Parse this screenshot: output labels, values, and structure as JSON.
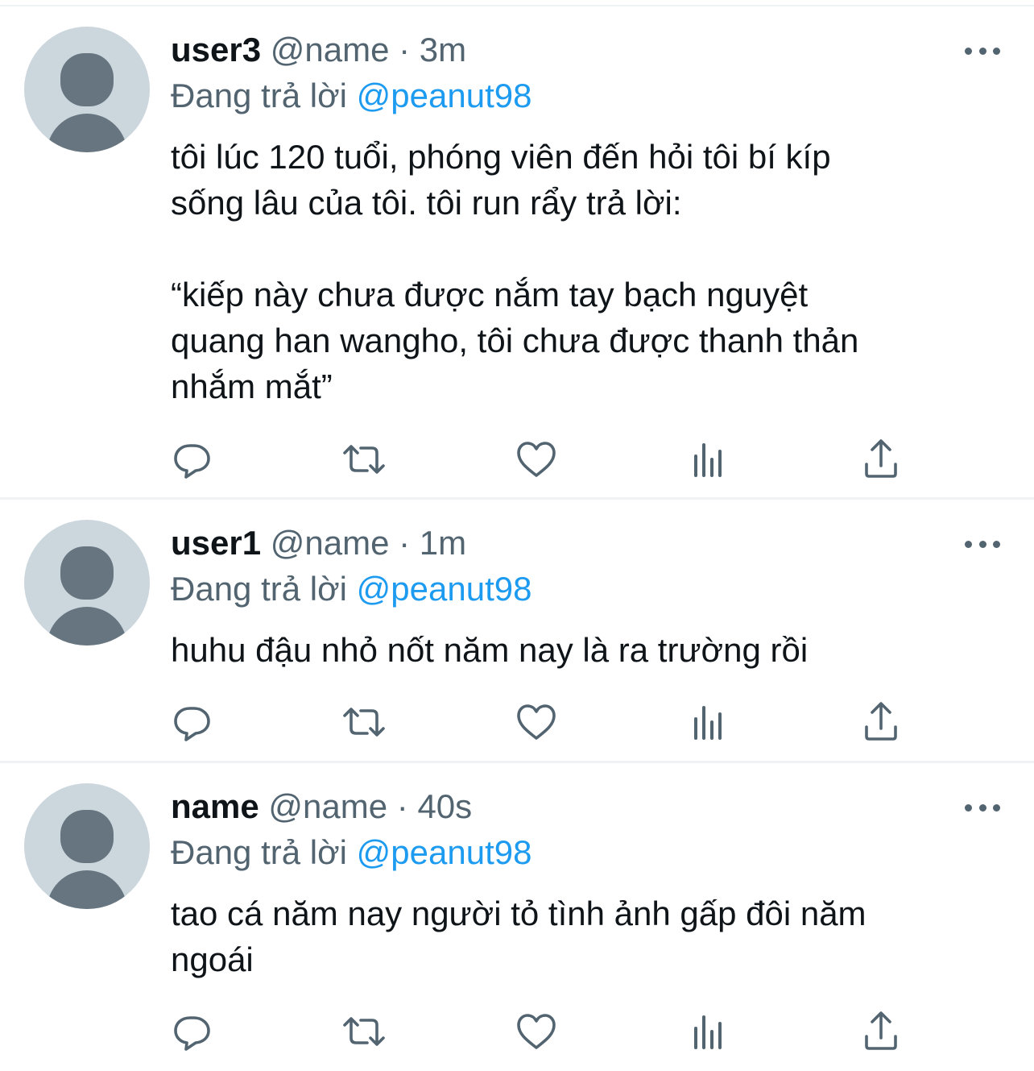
{
  "reply_prefix": "Đang trả lời",
  "more_icon": "more-horizontal-icon",
  "action_icons": [
    "reply-icon",
    "retweet-icon",
    "like-icon",
    "analytics-icon",
    "share-icon"
  ],
  "colors": {
    "text": "#0f1419",
    "secondary": "#536471",
    "mention": "#1d9bf0",
    "avatar_bg": "#ccd6dd",
    "avatar_fg": "#66757f",
    "divider": "#eff3f4"
  },
  "tweets": [
    {
      "display_name": "user3",
      "handle": "@name",
      "separator": "·",
      "time": "3m",
      "mention": "@peanut98",
      "text": "tôi lúc 120 tuổi, phóng viên đến hỏi tôi bí kíp\nsống lâu của tôi. tôi run rẩy trả lời:\n\n“kiếp này chưa được nắm tay bạch nguyệt\nquang han wangho, tôi chưa được thanh thản\nnhắm mắt”"
    },
    {
      "display_name": "user1",
      "handle": "@name",
      "separator": "·",
      "time": "1m",
      "mention": "@peanut98",
      "text": "huhu đậu nhỏ nốt năm nay là ra trường rồi"
    },
    {
      "display_name": "name",
      "handle": "@name",
      "separator": "·",
      "time": "40s",
      "mention": "@peanut98",
      "text": "tao cá năm nay người tỏ tình ảnh gấp đôi năm\nngoái"
    }
  ]
}
